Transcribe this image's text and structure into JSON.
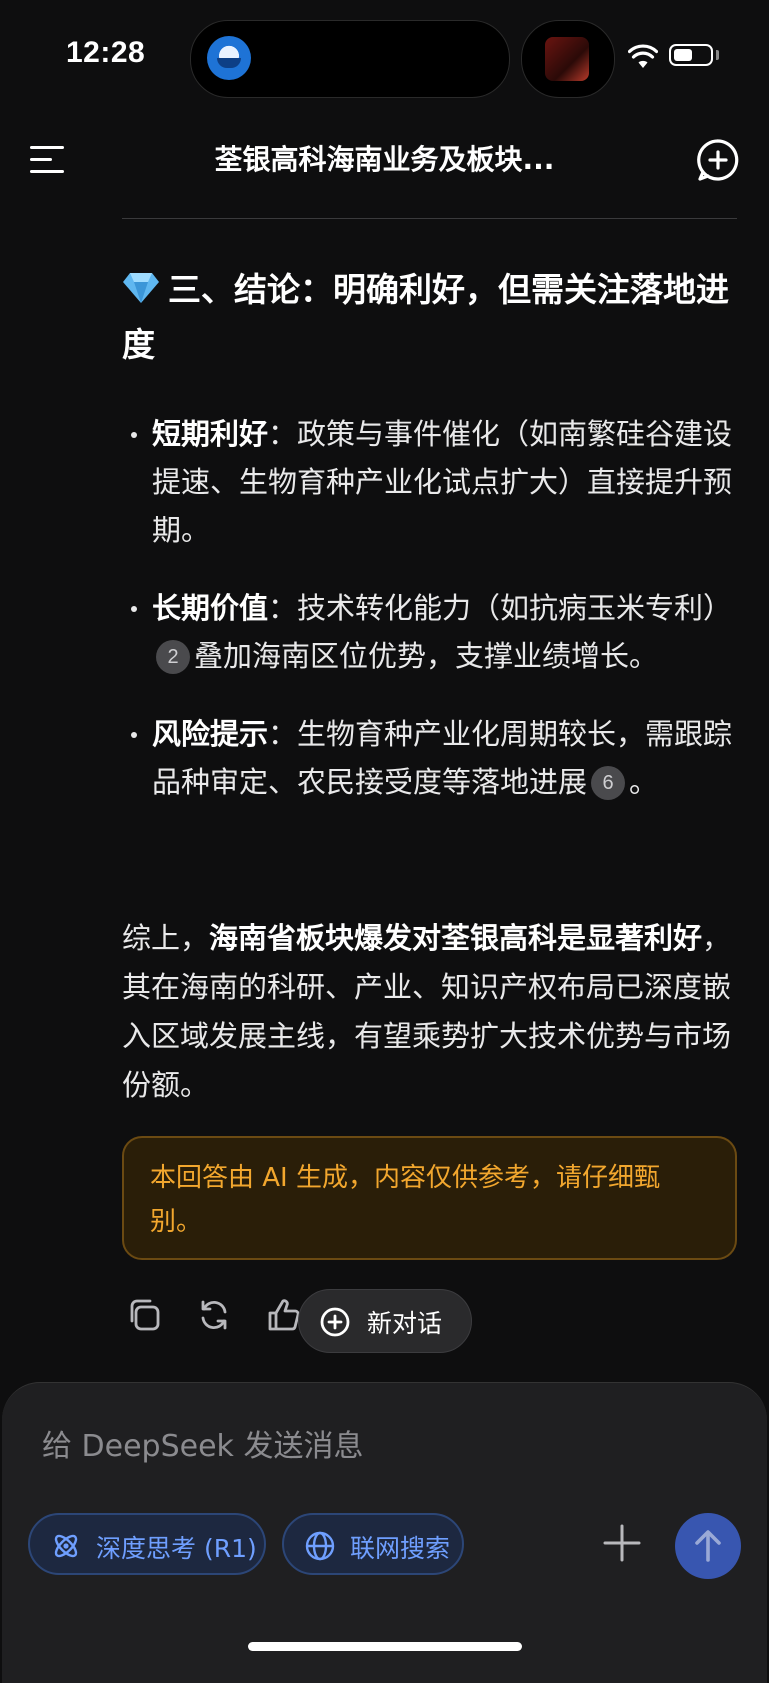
{
  "status_bar": {
    "time": "12:28"
  },
  "header": {
    "title": "荃银高科海南业务及板块..."
  },
  "section": {
    "title": "三、结论：明确利好，但需关注落地进度"
  },
  "bullets": [
    {
      "label": "短期利好",
      "sep": "：",
      "text": "政策与事件催化（如南繁硅谷建设提速、生物育种产业化试点扩大）直接提升预期。",
      "cite": null,
      "tail": ""
    },
    {
      "label": "长期价值",
      "sep": "：",
      "text": "技术转化能力（如抗病玉米专利）",
      "cite": "2",
      "tail": "叠加海南区位优势，支撑业绩增长。"
    },
    {
      "label": "风险提示",
      "sep": "：",
      "text": "生物育种产业化周期较长，需跟踪品种审定、农民接受度等落地进展",
      "cite": "6",
      "tail": "。"
    }
  ],
  "summary": {
    "prefix": "综上，",
    "bold": "海南省板块爆发对荃银高科是显著利好",
    "rest": "，其在海南的科研、产业、知识产权布局已深度嵌入区域发展主线，有望乘势扩大技术优势与市场份额。"
  },
  "notice": "本回答由 AI 生成，内容仅供参考，请仔细甄别。",
  "actions": {
    "new_chat_label": "新对话"
  },
  "composer": {
    "placeholder": "给 DeepSeek 发送消息",
    "deep_think_label": "深度思考 (R1)",
    "web_search_label": "联网搜索"
  },
  "colors": {
    "accent": "#6f9fff",
    "notice": "#f2a72e",
    "send": "#3856b0"
  }
}
